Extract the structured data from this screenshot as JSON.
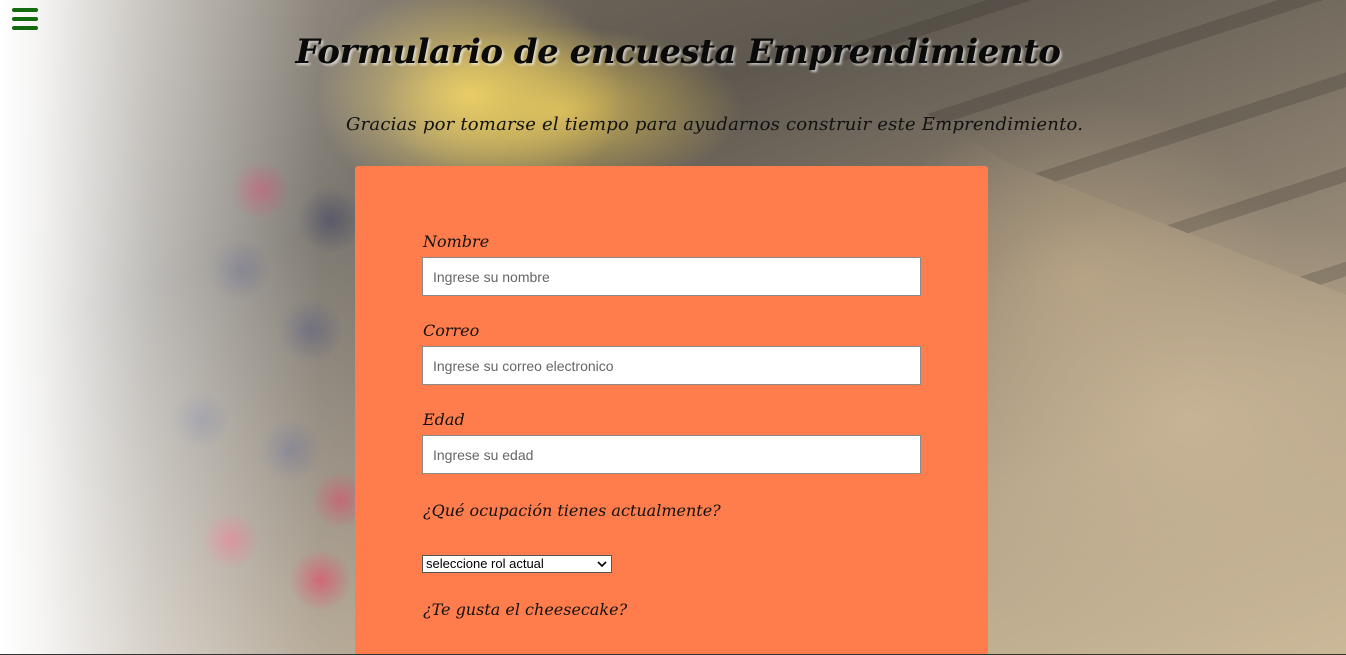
{
  "menu": {
    "icon": "hamburger-menu-icon",
    "color": "#126b0e"
  },
  "header": {
    "title": "Formulario de encuesta Emprendimiento",
    "description": "Gracias por tomarse el tiempo para ayudarnos construir este Emprendimiento."
  },
  "form": {
    "background_color": "#ff7d4c",
    "name": {
      "label": "Nombre",
      "placeholder": "Ingrese su nombre"
    },
    "email": {
      "label": "Correo",
      "placeholder": "Ingrese su correo electronico"
    },
    "age": {
      "label": "Edad",
      "placeholder": "Ingrese su edad"
    },
    "occupation": {
      "label": "¿Qué ocupación tienes actualmente?",
      "selected": "seleccione rol actual"
    },
    "cheesecake": {
      "label": "¿Te gusta el cheesecake?"
    }
  }
}
